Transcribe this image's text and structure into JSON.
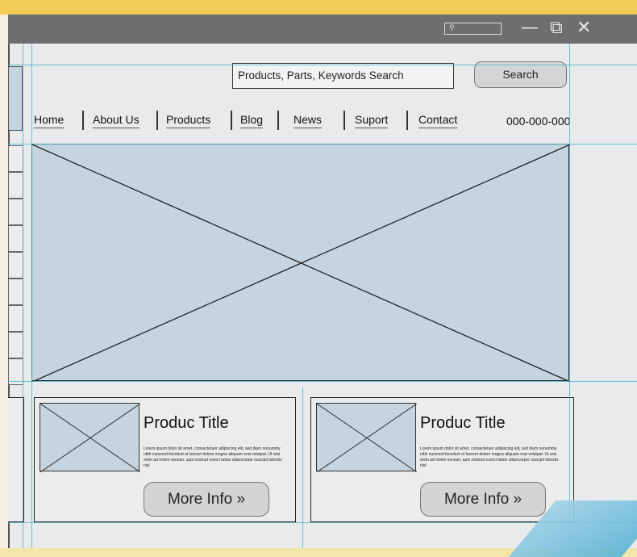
{
  "window": {
    "mini_search_icon": "magnifier-icon",
    "controls": {
      "minimize": "—",
      "maximize": "⧉",
      "close": "✕"
    }
  },
  "search": {
    "placeholder": "Products, Parts, Keywords Search",
    "button_label": "Search"
  },
  "nav": {
    "items": [
      "Home",
      "About Us",
      "Products",
      "Blog",
      "News",
      "Suport",
      "Contact"
    ],
    "phone": "000-000-000"
  },
  "cards": [
    {
      "title": "Produc Title",
      "description": "Lorem ipsum dolor sit amet, consectetuer adipiscing elit, sed diam nonummy nibh euismod tincidunt ut laoreet dolore magna aliquam erat volutpat. Ut wisi enim ad minim veniam, quis nostrud exerci tation ullamcorper suscipit lobortis nisl",
      "button_label": "More Info »"
    },
    {
      "title": "Produc Title",
      "description": "Lorem ipsum dolor sit amet, consectetuer adipiscing elit, sed diam nonummy nibh euismod tincidunt ut laoreet dolore magna aliquam erat volutpat. Ut wisi enim ad minim veniam, quis nostrud exerci tation ullamcorper suscipit lobortis nisl",
      "button_label": "More Info »"
    }
  ],
  "colors": {
    "placeholder_fill": "#c5d4de",
    "guide_line": "#3fb5d0",
    "titlebar": "#6e6e70",
    "background": "#f1cc57"
  }
}
